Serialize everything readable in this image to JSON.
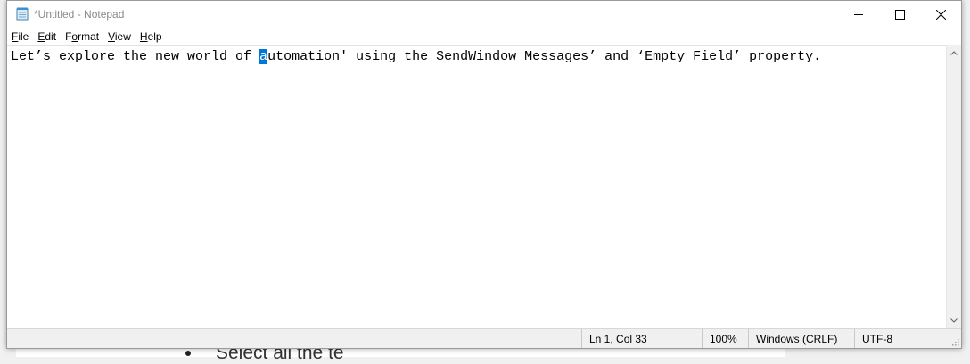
{
  "window": {
    "title": "*Untitled - Notepad"
  },
  "menu": [
    {
      "label": "File",
      "mnemonic": "F",
      "rest": "ile"
    },
    {
      "label": "Edit",
      "mnemonic": "E",
      "rest": "dit"
    },
    {
      "label": "Format",
      "mnemonic": "o",
      "pre": "F",
      "rest": "rmat"
    },
    {
      "label": "View",
      "mnemonic": "V",
      "rest": "iew"
    },
    {
      "label": "Help",
      "mnemonic": "H",
      "rest": "elp"
    }
  ],
  "editor": {
    "before_selection": "Let’s explore the new world of ",
    "selected": "a",
    "after_selection": "utomation' using the SendWindow Messages’ and ‘Empty Field’ property."
  },
  "status": {
    "position": "Ln 1, Col 33",
    "zoom": "100%",
    "line_ending": "Windows (CRLF)",
    "encoding": "UTF-8"
  },
  "background": {
    "bullet_text": "Select all the te"
  },
  "icons": {
    "app": "notepad-icon",
    "minimize": "minimize-icon",
    "maximize": "maximize-icon",
    "close": "close-icon",
    "scroll_up": "chevron-up-icon",
    "scroll_down": "chevron-down-icon",
    "grip": "resize-grip-icon"
  },
  "colors": {
    "selection": "#0078d7",
    "title_text": "#8a8a8a"
  }
}
